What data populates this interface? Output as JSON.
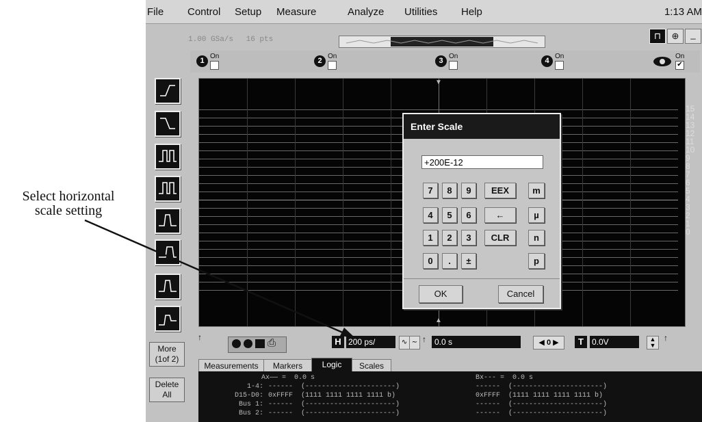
{
  "annotation": {
    "line1": "Select horizontal",
    "line2": "scale setting"
  },
  "menubar": {
    "items": [
      "File",
      "Control",
      "Setup",
      "Measure",
      "Analyze",
      "Utilities",
      "Help"
    ],
    "clock": "1:13 AM"
  },
  "acquisition": {
    "rate": "1.00 GSa/s",
    "points": "16 pts"
  },
  "channels": [
    {
      "number": "1",
      "label": "On"
    },
    {
      "number": "2",
      "label": "On"
    },
    {
      "number": "3",
      "label": "On"
    },
    {
      "number": "4",
      "label": "On"
    }
  ],
  "logic_channel": {
    "label": "On",
    "checked": true
  },
  "left_toolbar": {
    "more_label_1": "More",
    "more_label_2": "(1of 2)",
    "delete_label_1": "Delete",
    "delete_label_2": "All"
  },
  "grid": {
    "y_labels": [
      "15",
      "14",
      "13",
      "12",
      "11",
      "10",
      "9",
      "8",
      "7",
      "6",
      "5",
      "4",
      "3",
      "2",
      "1",
      "0"
    ]
  },
  "dialog": {
    "title": "Enter Scale",
    "input_value": "+200E-12",
    "keys_row1": [
      "7",
      "8",
      "9",
      "EEX",
      "m"
    ],
    "keys_row2": [
      "4",
      "5",
      "6",
      "←",
      "µ"
    ],
    "keys_row3": [
      "1",
      "2",
      "3",
      "CLR",
      "n"
    ],
    "keys_row4": [
      "0",
      ".",
      "±",
      "p"
    ],
    "ok_label": "OK",
    "cancel_label": "Cancel"
  },
  "bottom_controls": {
    "h_label": "H",
    "horizontal_scale": "200 ps/",
    "position_value": "0.0 s",
    "delay_value": "0",
    "t_label": "T",
    "trigger_level": "0.0V"
  },
  "tabs": [
    "Measurements",
    "Markers",
    "Logic",
    "Scales"
  ],
  "measurements": {
    "row1_left": "Ax—— =  0.0 s",
    "row1_right": "Bx--- =  0.0 s",
    "row2_label": "1-4:",
    "row2_a": "------  (----------------------)",
    "row2_b": "------  (----------------------)",
    "row3_label": "D15-D0:",
    "row3_a": "0xFFFF  (1111 1111 1111 1111 b)",
    "row3_b": "0xFFFF  (1111 1111 1111 1111 b)",
    "row4_label": "Bus 1:",
    "row4_a": "------  (----------------------)",
    "row4_b": "------  (----------------------)",
    "row5_label": "Bus 2:",
    "row5_a": "------  (----------------------)",
    "row5_b": "------  (----------------------)",
    "help": "?"
  }
}
